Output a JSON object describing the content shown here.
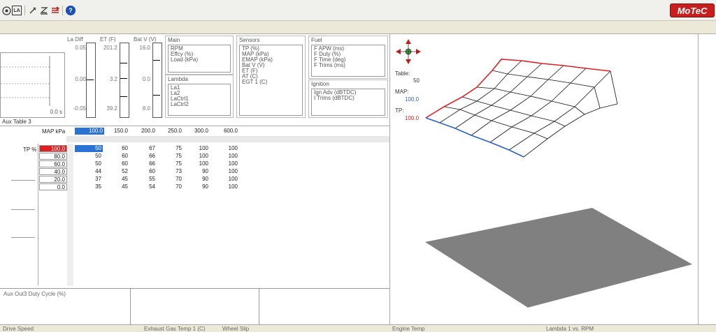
{
  "toolbar": {
    "icons": [
      "gauge-icon",
      "la-icon",
      "tool-icon",
      "z-icon",
      "table-icon",
      "help-icon"
    ],
    "la_text": "LA",
    "help_text": "?",
    "logo": "MoTeC"
  },
  "gauges": [
    {
      "title": "La Diff",
      "top": "0.05",
      "mid": "0.00",
      "bot": "-0.05"
    },
    {
      "title": "ET (F)",
      "top": "201.2",
      "mid": "3.2",
      "bot": "39.2"
    },
    {
      "title": "Bat V (V)",
      "top": "16.0",
      "mid": "0.0",
      "bot": "8.0"
    }
  ],
  "time_label": "0.0 s",
  "groups": {
    "main": {
      "title": "Main",
      "items": [
        "RPM",
        "Effcy (%)",
        "Load (kPa)"
      ]
    },
    "lambda": {
      "title": "Lambda",
      "items": [
        "La1",
        "La2",
        "LaCtrl1",
        "LaCtrl2"
      ]
    },
    "sensors": {
      "title": "Sensors",
      "items": [
        "TP (%)",
        "MAP (kPa)",
        "EMAP (kPa)",
        "Bat V (V)",
        "ET (F)",
        "AT (C)",
        "EGT 1 (C)"
      ]
    },
    "fuel": {
      "title": "Fuel",
      "items": [
        "F APW (ms)",
        "F Duty (%)",
        "F Time (deg)",
        "F Trims (ms)"
      ]
    },
    "ignition": {
      "title": "Ignition",
      "items": [
        "Ign Adv (dBTDC)",
        "I Trims (dBTDC)"
      ]
    }
  },
  "table": {
    "title": "Aux Table 3",
    "x_label": "MAP kPa",
    "y_label": "TP %",
    "x_values": [
      "100.0",
      "150.0",
      "200.0",
      "250.0",
      "300.0",
      "600.0"
    ],
    "y_values": [
      "100.0",
      "80.0",
      "60.0",
      "40.0",
      "20.0",
      "0.0"
    ],
    "rows": [
      [
        "50",
        "60",
        "67",
        "75",
        "100",
        "100"
      ],
      [
        "50",
        "60",
        "66",
        "75",
        "100",
        "100"
      ],
      [
        "50",
        "60",
        "66",
        "75",
        "100",
        "100"
      ],
      [
        "44",
        "52",
        "60",
        "73",
        "90",
        "100"
      ],
      [
        "37",
        "45",
        "55",
        "70",
        "90",
        "100"
      ],
      [
        "35",
        "45",
        "54",
        "70",
        "90",
        "100"
      ]
    ]
  },
  "bottom": {
    "aux_label": "Aux Out3 Duty Cycle (%)"
  },
  "view3d": {
    "table_label": "Table:",
    "table_value": "50",
    "map_label": "MAP:",
    "map_value": "100.0",
    "tp_label": "TP:",
    "tp_value": "100.0",
    "map_color": "#2a5fd0",
    "tp_color": "#e02020"
  },
  "status": {
    "drive_speed": "Drive Speed",
    "exhaust_gas": "Exhaust Gas Temp 1 (C)",
    "wheel_slip": "Wheel Slip",
    "engine_temp": "Engine Temp",
    "lambda_rpm": "Lambda 1 vs. RPM"
  }
}
